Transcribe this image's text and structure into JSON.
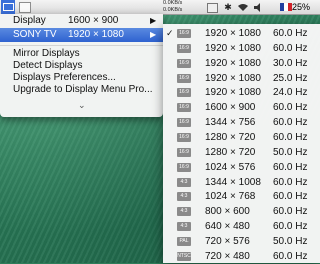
{
  "menubar": {
    "net_up": "0.0KB/s",
    "net_down": "0.0KB/s",
    "battery_percent": "25%"
  },
  "menu": {
    "display_row": {
      "label": "Display",
      "value": "1600 × 900"
    },
    "sony_row": {
      "label": "SONY TV",
      "value": "1920 × 1080"
    },
    "items": [
      "Mirror Displays",
      "Detect Displays",
      "Displays Preferences...",
      "Upgrade to Display Menu Pro..."
    ],
    "more_glyph": "⌄"
  },
  "submenu": {
    "checkmark": "✓",
    "rows": [
      {
        "badge": "16:9",
        "res": "1920 × 1080",
        "hz": "60.0 Hz",
        "checked": true
      },
      {
        "badge": "16:9",
        "res": "1920 × 1080",
        "hz": "60.0 Hz"
      },
      {
        "badge": "16:9",
        "res": "1920 × 1080",
        "hz": "30.0 Hz"
      },
      {
        "badge": "16:9",
        "res": "1920 × 1080",
        "hz": "25.0 Hz"
      },
      {
        "badge": "16:9",
        "res": "1920 × 1080",
        "hz": "24.0 Hz"
      },
      {
        "badge": "16:9",
        "res": "1600 × 900",
        "hz": "60.0 Hz"
      },
      {
        "badge": "16:9",
        "res": "1344 × 756",
        "hz": "60.0 Hz"
      },
      {
        "badge": "16:9",
        "res": "1280 × 720",
        "hz": "60.0 Hz"
      },
      {
        "badge": "16:9",
        "res": "1280 × 720",
        "hz": "50.0 Hz"
      },
      {
        "badge": "16:9",
        "res": "1024 × 576",
        "hz": "60.0 Hz"
      },
      {
        "badge": "4:3",
        "res": "1344 × 1008",
        "hz": "60.0 Hz"
      },
      {
        "badge": "4:3",
        "res": "1024 × 768",
        "hz": "60.0 Hz"
      },
      {
        "badge": "4:3",
        "res": "800 × 600",
        "hz": "60.0 Hz"
      },
      {
        "badge": "4:3",
        "res": "640 × 480",
        "hz": "60.0 Hz"
      },
      {
        "badge": "PAL",
        "res": "720 × 576",
        "hz": "50.0 Hz"
      },
      {
        "badge": "NTSC",
        "res": "720 × 480",
        "hz": "60.0 Hz"
      }
    ]
  }
}
